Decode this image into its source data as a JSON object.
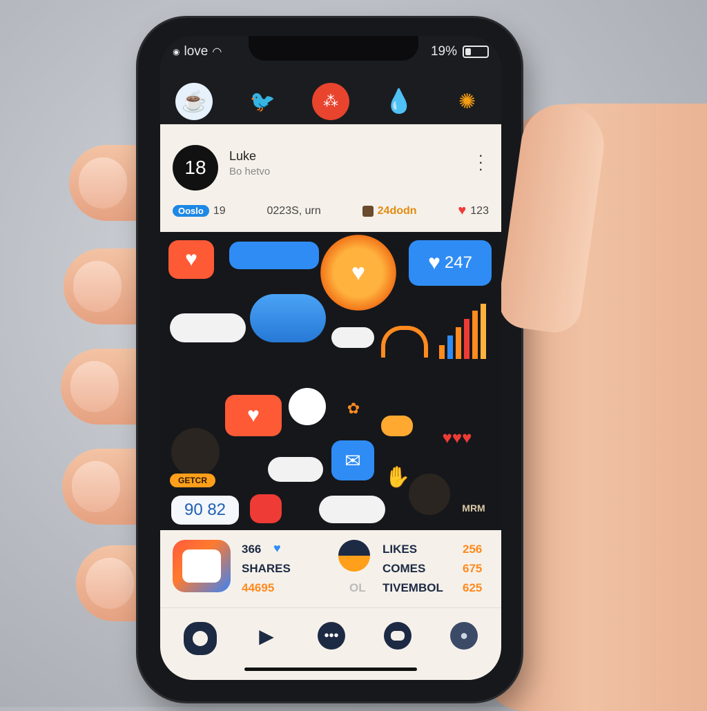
{
  "status": {
    "carrier": "love",
    "battery": "19%"
  },
  "topicons": [
    "coffee-icon",
    "bird-icon",
    "dots-icon",
    "drop-icon",
    "light-icon"
  ],
  "profile": {
    "avatar_text": "18",
    "name": "Luke",
    "subtitle": "Bo hetvo",
    "stats": [
      {
        "label": "Ooslo",
        "value": "19"
      },
      {
        "value": "0223S, urn"
      },
      {
        "value": "24dodn"
      },
      {
        "value": "123"
      }
    ]
  },
  "feed": {
    "heart_bubble_count": "247",
    "score_bubble": "90 82",
    "badge_text": "GETCR",
    "sign_text": "MRM"
  },
  "stats": {
    "left": {
      "top": "366",
      "label": "SHARES",
      "value": "44695"
    },
    "right": [
      {
        "label": "LIKES",
        "value": "256"
      },
      {
        "label": "COMES",
        "value": "675"
      },
      {
        "label": "TIVEMBOL",
        "value": "625"
      }
    ],
    "small": "OL"
  },
  "colors": {
    "accent": "#1e88e5",
    "heart": "#ef3b35",
    "orange": "#ff8a1f"
  }
}
